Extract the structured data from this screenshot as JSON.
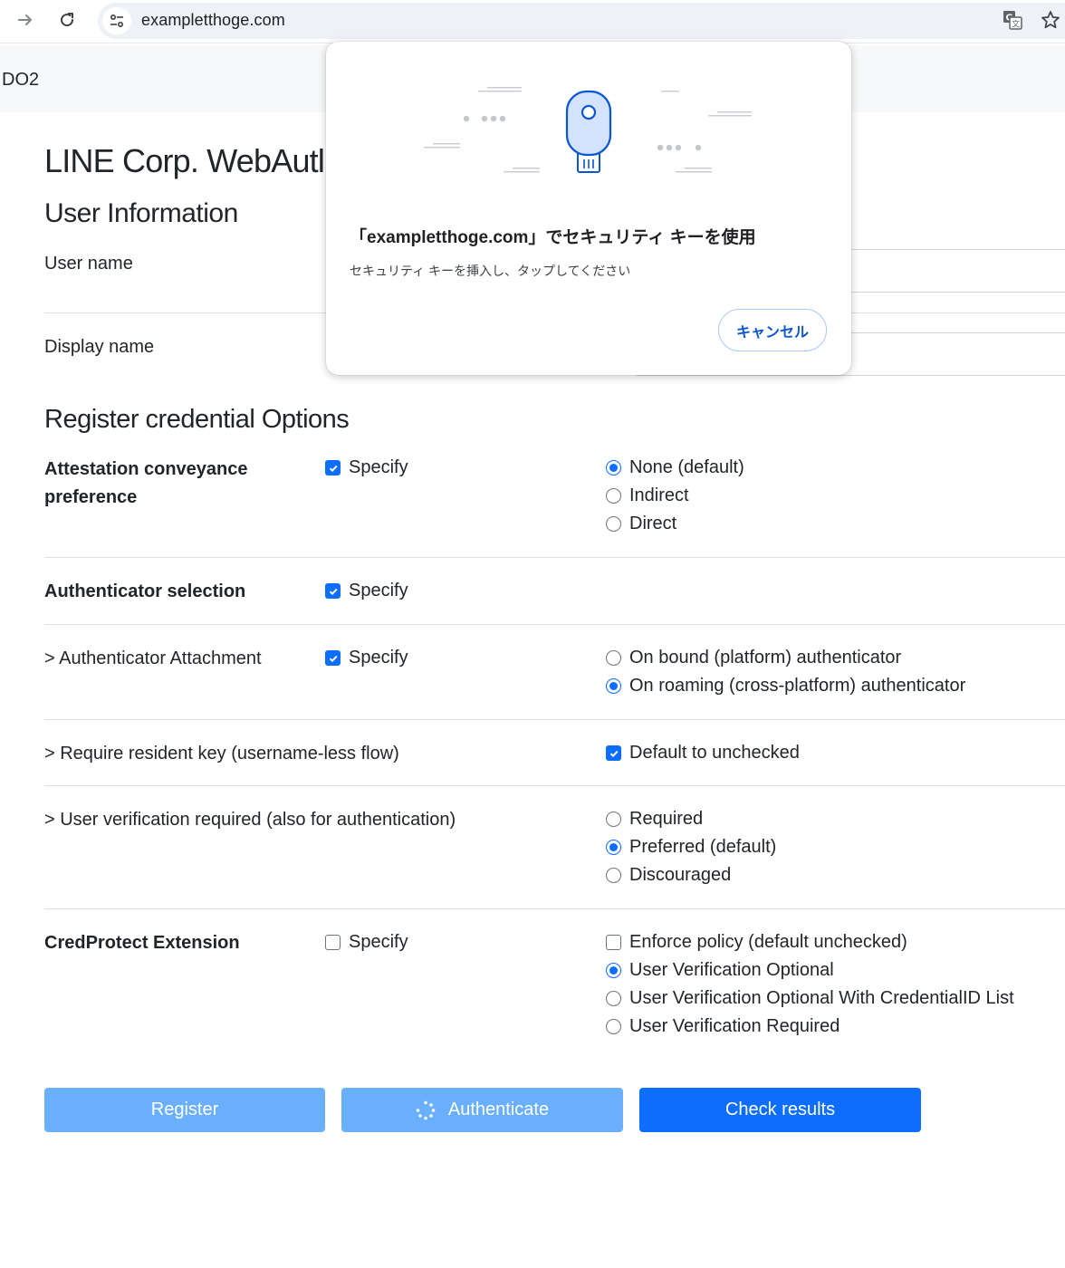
{
  "browser": {
    "url": "exampletthoge.com"
  },
  "navbar": {
    "brand": "DO2"
  },
  "page": {
    "title": "LINE Corp. WebAutl",
    "user_info_heading": "User Information",
    "user_name_label": "User name",
    "display_name_label": "Display name",
    "options_heading": "Register credential Options"
  },
  "options": {
    "attestation": {
      "label_line1": "Attestation conveyance",
      "label_line2": "preference",
      "specify_label": "Specify",
      "specify_checked": true,
      "choices": [
        {
          "label": "None (default)",
          "selected": true
        },
        {
          "label": "Indirect",
          "selected": false
        },
        {
          "label": "Direct",
          "selected": false
        }
      ]
    },
    "authenticator_selection": {
      "label": "Authenticator selection",
      "specify_label": "Specify",
      "specify_checked": true
    },
    "attachment": {
      "label": "> Authenticator Attachment",
      "specify_label": "Specify",
      "specify_checked": true,
      "choices": [
        {
          "label": "On bound (platform) authenticator",
          "selected": false
        },
        {
          "label": "On roaming (cross-platform) authenticator",
          "selected": true
        }
      ]
    },
    "resident_key": {
      "label": "> Require resident key (username-less flow)",
      "option_label": "Default to unchecked",
      "option_checked": true
    },
    "user_verification": {
      "label": "> User verification required (also for authentication)",
      "choices": [
        {
          "label": "Required",
          "selected": false
        },
        {
          "label": "Preferred (default)",
          "selected": true
        },
        {
          "label": "Discouraged",
          "selected": false
        }
      ]
    },
    "cred_protect": {
      "label": "CredProtect Extension",
      "specify_label": "Specify",
      "specify_checked": false,
      "enforce_label": "Enforce policy (default unchecked)",
      "enforce_checked": false,
      "choices": [
        {
          "label": "User Verification Optional",
          "selected": true
        },
        {
          "label": "User Verification Optional With CredentialID List",
          "selected": false
        },
        {
          "label": "User Verification Required",
          "selected": false
        }
      ]
    }
  },
  "buttons": {
    "register": "Register",
    "authenticate": "Authenticate",
    "check_results": "Check results"
  },
  "dialog": {
    "title": "「exampletthoge.com」でセキュリティ キーを使用",
    "subtitle": "セキュリティ キーを挿入し、タップしてください",
    "cancel_label": "キャンセル"
  },
  "colors": {
    "primary": "#0d6efd",
    "primary_disabled": "#6aaffc",
    "dialog_button_text": "#0b57d0"
  }
}
